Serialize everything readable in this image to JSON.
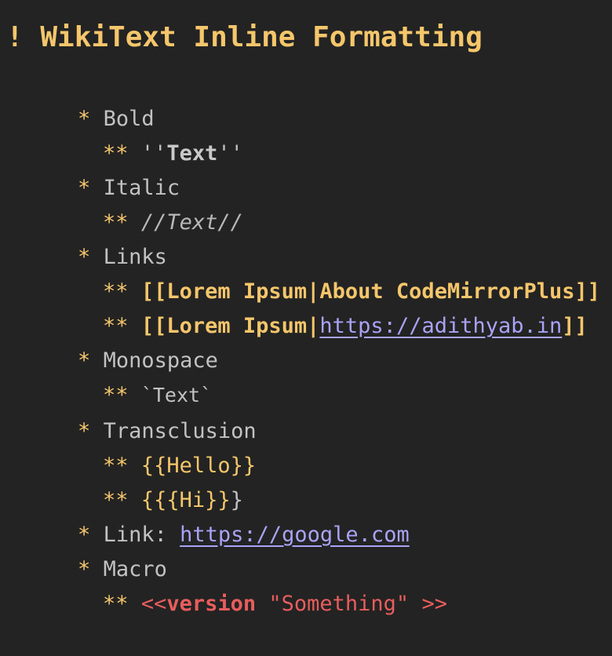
{
  "heading": "! WikiText Inline Formatting",
  "lines": {
    "bold": {
      "bullet": "*",
      "label": "Bold"
    },
    "bold_ex": {
      "bullet": "**",
      "open": "''",
      "text": "Text",
      "close": "''"
    },
    "italic": {
      "bullet": "*",
      "label": "Italic"
    },
    "italic_ex": {
      "bullet": "**",
      "text": "//Text//"
    },
    "links": {
      "bullet": "*",
      "label": "Links"
    },
    "link_ex1": {
      "bullet": "**",
      "open": "[[",
      "text": "Lorem Ipsum|About CodeMirrorPlus",
      "close": "]]"
    },
    "link_ex2": {
      "bullet": "**",
      "open": "[[",
      "text": "Lorem Ipsum|",
      "url": "https://adithyab.in",
      "close": "]]"
    },
    "mono": {
      "bullet": "*",
      "label": "Monospace"
    },
    "mono_ex": {
      "bullet": "**",
      "text": "`Text`"
    },
    "transclusion": {
      "bullet": "*",
      "label": "Transclusion"
    },
    "trans_ex1": {
      "bullet": "**",
      "text": "{{Hello}}"
    },
    "trans_ex2": {
      "bullet": "**",
      "outer_open": "{",
      "text": "{{Hi}}",
      "outer_close": "}"
    },
    "link_line": {
      "bullet": "*",
      "label": "Link: ",
      "url": "https://google.com"
    },
    "macro": {
      "bullet": "*",
      "label": "Macro"
    },
    "macro_ex": {
      "bullet": "**",
      "open": "<<",
      "name": "version",
      "arg": " \"Something\"",
      "close": " >>"
    }
  },
  "colors": {
    "background": "#232323",
    "heading": "#f5c66b",
    "bullet": "#f5c66b",
    "text": "#c2c2c2",
    "link": "#f5c66b",
    "url": "#a9a3f7",
    "macro": "#e85d5d"
  }
}
